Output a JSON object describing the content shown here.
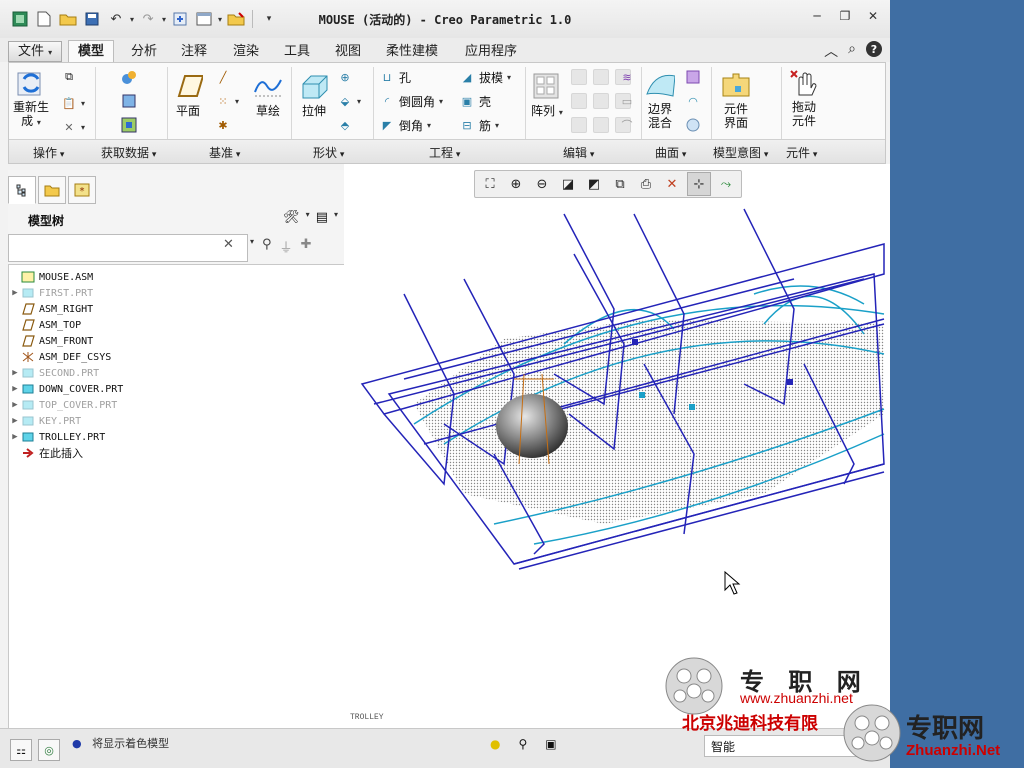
{
  "window": {
    "title": "MOUSE (活动的) - Creo Parametric 1.0",
    "controls": [
      "minimize",
      "restore",
      "close"
    ]
  },
  "quick_access": [
    "new-icon",
    "open-icon",
    "save-icon",
    "undo-icon",
    "redo-icon",
    "regenerate-icon",
    "windows-icon",
    "close-window-icon",
    "customize-icon"
  ],
  "tabs": [
    {
      "label": "文件"
    },
    {
      "label": "模型"
    },
    {
      "label": "分析"
    },
    {
      "label": "注释"
    },
    {
      "label": "渲染"
    },
    {
      "label": "工具"
    },
    {
      "label": "视图"
    },
    {
      "label": "柔性建模"
    },
    {
      "label": "应用程序"
    }
  ],
  "ribbon": {
    "regenerate": "重新生成",
    "regenerate_line1": "重新生",
    "regenerate_line2": "成",
    "plane": "平面",
    "sketch": "草绘",
    "extrude": "拉伸",
    "hole": "孔",
    "round": "倒圆角",
    "chamfer": "倒角",
    "draft": "拔模",
    "shell": "壳",
    "rib": "筋",
    "pattern": "阵列",
    "blend_line1": "边界",
    "blend_line2": "混合",
    "component_line1": "元件",
    "component_line2": "界面",
    "drag_line1": "拖动",
    "drag_line2": "元件",
    "groups": {
      "operations": "操作",
      "get_data": "获取数据",
      "datum": "基准",
      "shapes": "形状",
      "engineering": "工程",
      "editing": "编辑",
      "surfaces": "曲面",
      "model_intent": "模型意图",
      "components": "元件"
    }
  },
  "model_tree": {
    "title": "模型树",
    "search_placeholder": "",
    "items": [
      {
        "label": "MOUSE.ASM",
        "dim": false,
        "expandable": false,
        "icon": "assembly-icon"
      },
      {
        "label": "FIRST.PRT",
        "dim": true,
        "expandable": true,
        "icon": "part-icon"
      },
      {
        "label": "ASM_RIGHT",
        "dim": false,
        "expandable": false,
        "icon": "datum-plane-icon"
      },
      {
        "label": "ASM_TOP",
        "dim": false,
        "expandable": false,
        "icon": "datum-plane-icon"
      },
      {
        "label": "ASM_FRONT",
        "dim": false,
        "expandable": false,
        "icon": "datum-plane-icon"
      },
      {
        "label": "ASM_DEF_CSYS",
        "dim": false,
        "expandable": false,
        "icon": "csys-icon"
      },
      {
        "label": "SECOND.PRT",
        "dim": true,
        "expandable": true,
        "icon": "part-icon"
      },
      {
        "label": "DOWN_COVER.PRT",
        "dim": false,
        "expandable": true,
        "icon": "part-icon"
      },
      {
        "label": "TOP_COVER.PRT",
        "dim": true,
        "expandable": true,
        "icon": "part-icon"
      },
      {
        "label": "KEY.PRT",
        "dim": true,
        "expandable": true,
        "icon": "part-icon"
      },
      {
        "label": "TROLLEY.PRT",
        "dim": false,
        "expandable": true,
        "icon": "part-icon"
      },
      {
        "label": "在此插入",
        "dim": false,
        "expandable": false,
        "icon": "insert-here-icon"
      }
    ]
  },
  "viewport": {
    "bottom_label": "TROLLEY",
    "toolbar": [
      "refit-icon",
      "zoom-in-icon",
      "zoom-out-icon",
      "repaint-icon",
      "display-style-icon",
      "saved-views-icon",
      "view-manager-icon",
      "datum-display-icon",
      "spin-center-icon",
      "annotation-display-icon"
    ]
  },
  "status": {
    "message": "将显示着色模型",
    "filter": "智能"
  },
  "watermark": {
    "brand": "专 职 网",
    "url": "www.zhuanzhi.net",
    "company": "北京兆迪科技有限",
    "brand2": "专职网",
    "url2": "Zhuanzhi.Net"
  },
  "colors": {
    "accent_blue": "#2424b8",
    "cyan": "#1aa0c8",
    "desktop": "#3f6ea3",
    "watermark_red": "#cc0000"
  }
}
